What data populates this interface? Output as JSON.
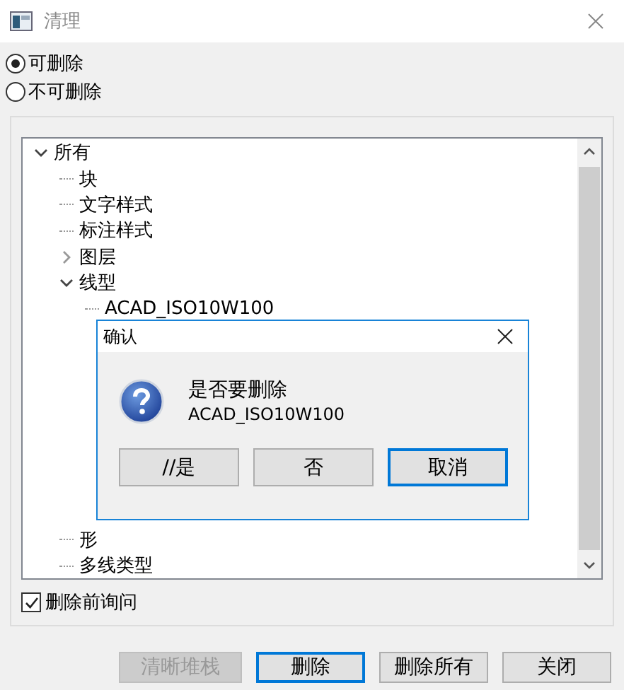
{
  "window": {
    "title": "清理"
  },
  "filter_options": [
    {
      "label": "可删除",
      "selected": true
    },
    {
      "label": "不可删除",
      "selected": false
    }
  ],
  "tree": [
    {
      "label": "所有",
      "expanded": true,
      "children": [
        {
          "label": "块"
        },
        {
          "label": "文字样式"
        },
        {
          "label": "标注样式"
        },
        {
          "label": "图层",
          "expanded": false
        },
        {
          "label": "线型",
          "expanded": true,
          "children": [
            {
              "label": "ACAD_ISO10W100"
            }
          ]
        },
        {
          "label": "形"
        },
        {
          "label": "多线类型"
        }
      ]
    }
  ],
  "confirm_before_delete": {
    "label": "删除前询问",
    "checked": true
  },
  "buttons": [
    {
      "label": "清晰堆栈",
      "disabled": true,
      "default": false
    },
    {
      "label": "删除",
      "disabled": false,
      "default": true
    },
    {
      "label": "删除所有",
      "disabled": false,
      "default": false
    },
    {
      "label": "关闭",
      "disabled": false,
      "default": false
    }
  ],
  "dialog": {
    "title": "确认",
    "message": "是否要删除",
    "item": "ACAD_ISO10W100",
    "buttons": [
      {
        "label": "//是",
        "focused": false
      },
      {
        "label": "否",
        "focused": false
      },
      {
        "label": "取消",
        "focused": true
      }
    ]
  }
}
